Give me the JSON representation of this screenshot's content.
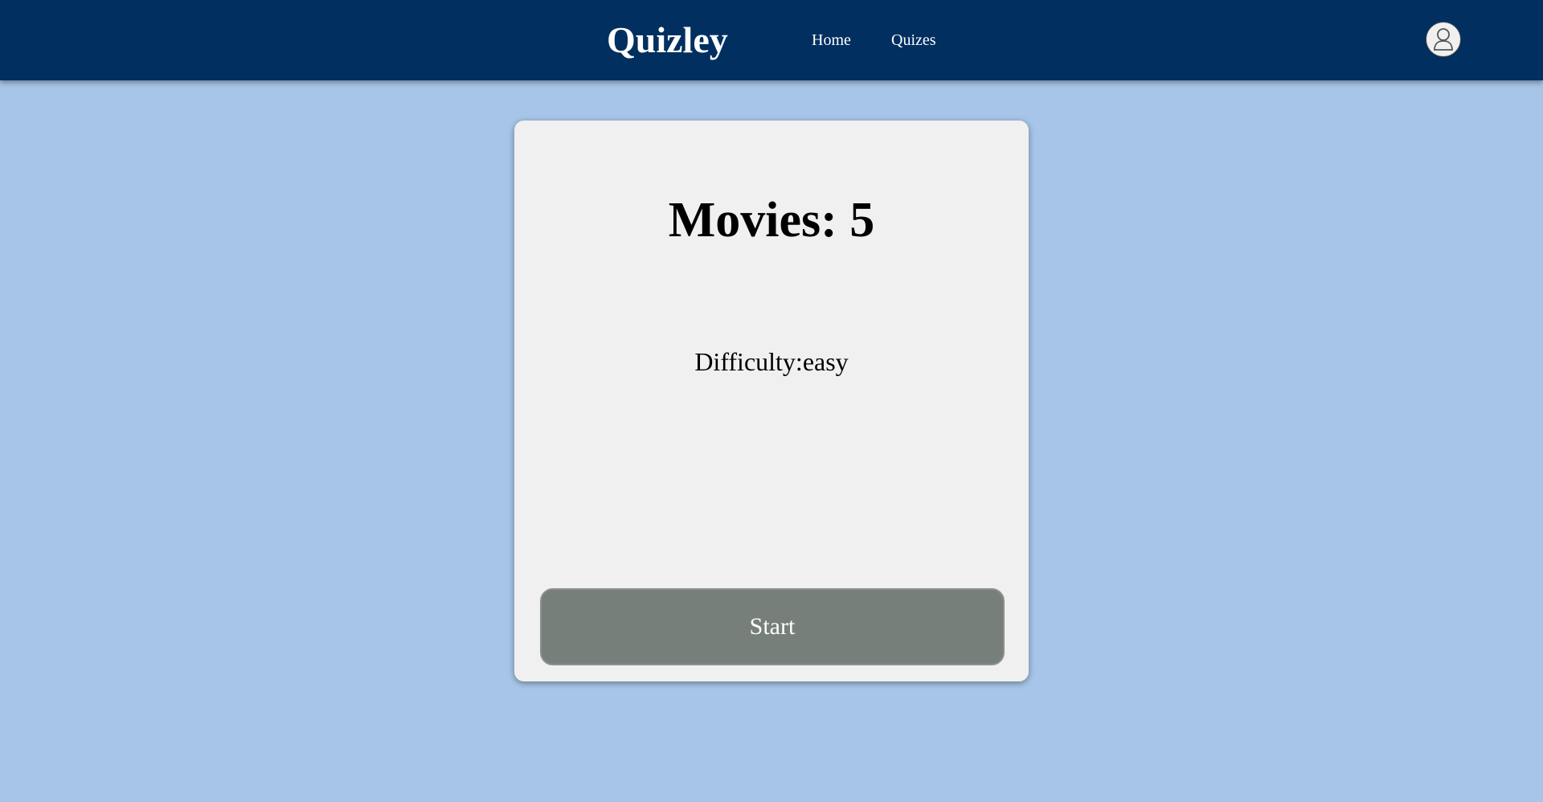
{
  "header": {
    "brand": "Quizley",
    "nav": [
      {
        "label": "Home"
      },
      {
        "label": "Quizes"
      }
    ],
    "avatar_icon": "user-icon",
    "colors": {
      "background": "#002f60",
      "text": "#ffffff"
    }
  },
  "quiz": {
    "title": "Movies: 5",
    "difficulty": "Difficulty:easy",
    "start_label": "Start"
  },
  "colors": {
    "page_background": "#a7c5e8",
    "card_background": "#f0f0f0",
    "button_background": "#777f7b"
  }
}
